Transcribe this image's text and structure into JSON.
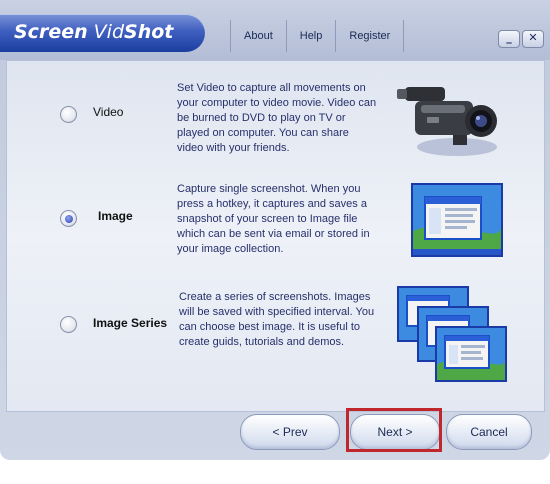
{
  "app": {
    "logo_part1": "Screen",
    "logo_part2": "Vid",
    "logo_part3": "Shot"
  },
  "menu": {
    "about": "About",
    "help": "Help",
    "register": "Register"
  },
  "window_controls": {
    "minimize": "_",
    "close": "✕"
  },
  "options": [
    {
      "label": "Video",
      "selected": false,
      "description": "Set Video to capture all movements on your computer to video movie. Video can be burned to DVD to play on TV or played on computer. You can share video with your friends.",
      "icon": "camcorder-icon"
    },
    {
      "label": "Image",
      "selected": true,
      "description": "Capture single screenshot. When you press a hotkey, it captures and saves a snapshot of your screen to Image file which can be sent via email or stored in your image collection.",
      "icon": "screenshot-icon"
    },
    {
      "label": "Image Series",
      "selected": false,
      "description": "Create a series of screenshots. Images will be saved with specified interval. You can choose best image. It is useful to create guids, tutorials and demos.",
      "icon": "screenshot-series-icon"
    }
  ],
  "buttons": {
    "prev": "< Prev",
    "next": "Next >",
    "cancel": "Cancel"
  },
  "colors": {
    "accent": "#3f5fc0",
    "highlight": "#c0272d"
  }
}
